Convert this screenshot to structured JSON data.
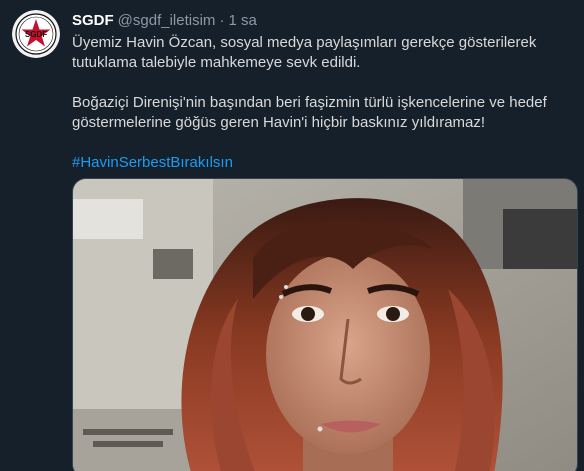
{
  "tweet": {
    "author": {
      "display_name": "SGDF",
      "handle": "@sgdf_iletisim",
      "avatar_text": "SGDF"
    },
    "separator": "·",
    "timestamp": "1 sa",
    "paragraph_1": "Üyemiz Havin Özcan, sosyal medya paylaşımları gerekçe gösterilerek tutuklama talebiyle mahkemeye sevk edildi.",
    "paragraph_2": "Boğaziçi Direnişi'nin başından beri faşizmin türlü işkencelerine ve hedef göstermelerine göğüs geren Havin'i hiçbir baskınız yıldıramaz!",
    "hashtag": "#HavinSerbestBırakılsın",
    "media": {
      "type": "photo"
    }
  },
  "colors": {
    "background": "#15202b",
    "text": "#d9d9d9",
    "secondary_text": "#8b98a5",
    "link": "#1d9bf0",
    "logo_red": "#c8102e"
  }
}
